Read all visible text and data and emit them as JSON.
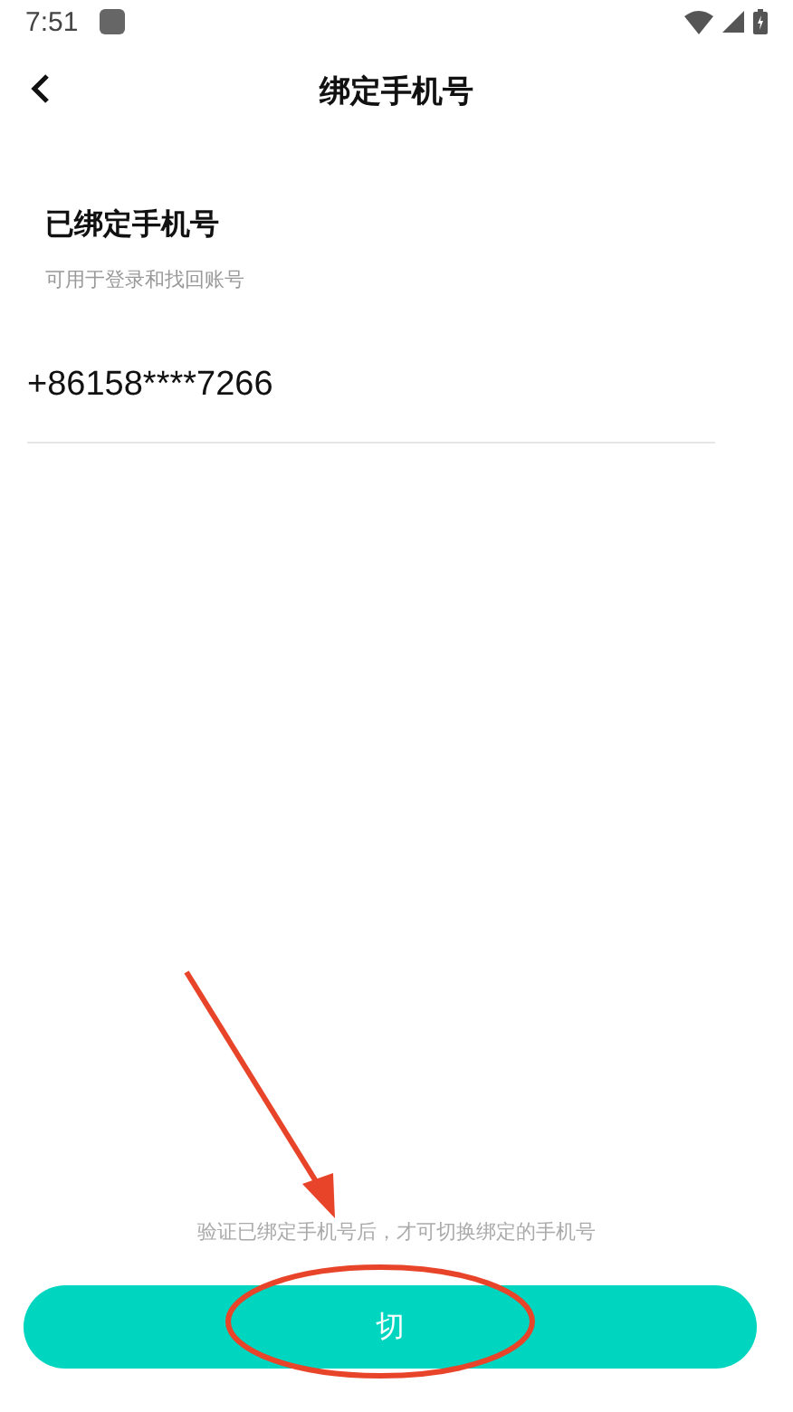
{
  "status_bar": {
    "time": "7:51"
  },
  "header": {
    "title": "绑定手机号"
  },
  "section": {
    "title": "已绑定手机号",
    "subtitle": "可用于登录和找回账号",
    "phone": "+86158****7266"
  },
  "hint": "验证已绑定手机号后，才可切换绑定的手机号",
  "button": {
    "label": "切"
  }
}
